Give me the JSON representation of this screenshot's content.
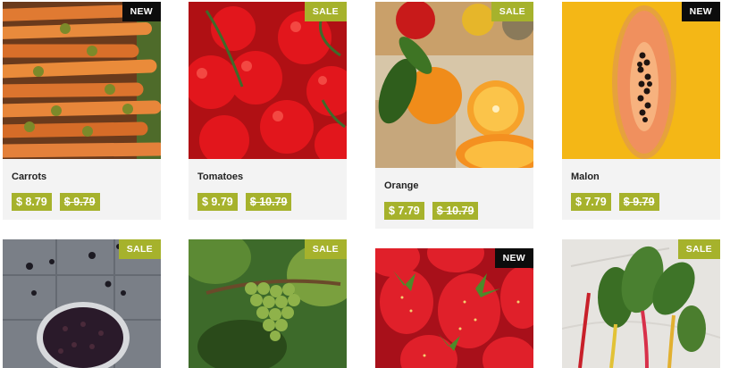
{
  "products": [
    {
      "name": "Carrots",
      "price": "$ 8.79",
      "old_price": "$ 9.79",
      "badge": "NEW"
    },
    {
      "name": "Tomatoes",
      "price": "$ 9.79",
      "old_price": "$ 10.79",
      "badge": "SALE"
    },
    {
      "name": "Orange",
      "price": "$ 7.79",
      "old_price": "$ 10.79",
      "badge": "SALE"
    },
    {
      "name": "Malon",
      "price": "$ 7.79",
      "old_price": "$ 9.79",
      "badge": "NEW"
    },
    {
      "name": "",
      "price": "",
      "old_price": "",
      "badge": "SALE"
    },
    {
      "name": "",
      "price": "",
      "old_price": "",
      "badge": "SALE"
    },
    {
      "name": "",
      "price": "",
      "old_price": "",
      "badge": "NEW"
    },
    {
      "name": "",
      "price": "",
      "old_price": "",
      "badge": "SALE"
    }
  ],
  "colors": {
    "accent": "#a6b22c",
    "new_badge": "#0c0c0c",
    "card_bg": "#f3f3f3"
  }
}
